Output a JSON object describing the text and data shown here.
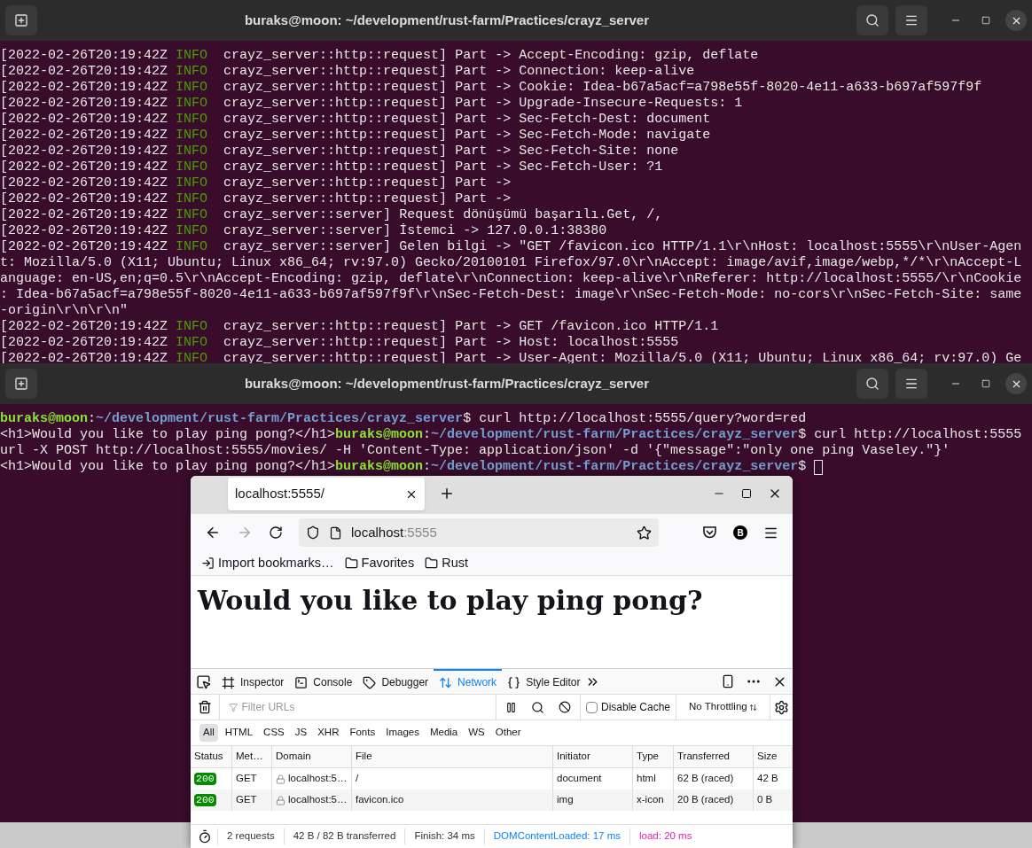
{
  "terminals": [
    {
      "title": "buraks@moon: ~/development/rust-farm/Practices/crayz_server",
      "lines": [
        {
          "kind": "log",
          "timestamp": "[2022-02-26T20:19:42Z",
          "level": "INFO",
          "target": "crayz_server::http::request]",
          "message": "Part -> Accept-Encoding: gzip, deflate"
        },
        {
          "kind": "log",
          "timestamp": "[2022-02-26T20:19:42Z",
          "level": "INFO",
          "target": "crayz_server::http::request]",
          "message": "Part -> Connection: keep-alive"
        },
        {
          "kind": "log",
          "timestamp": "[2022-02-26T20:19:42Z",
          "level": "INFO",
          "target": "crayz_server::http::request]",
          "message": "Part -> Cookie: Idea-b67a5acf=a798e55f-8020-4e11-a633-b697af597f9f"
        },
        {
          "kind": "log",
          "timestamp": "[2022-02-26T20:19:42Z",
          "level": "INFO",
          "target": "crayz_server::http::request]",
          "message": "Part -> Upgrade-Insecure-Requests: 1"
        },
        {
          "kind": "log",
          "timestamp": "[2022-02-26T20:19:42Z",
          "level": "INFO",
          "target": "crayz_server::http::request]",
          "message": "Part -> Sec-Fetch-Dest: document"
        },
        {
          "kind": "log",
          "timestamp": "[2022-02-26T20:19:42Z",
          "level": "INFO",
          "target": "crayz_server::http::request]",
          "message": "Part -> Sec-Fetch-Mode: navigate"
        },
        {
          "kind": "log",
          "timestamp": "[2022-02-26T20:19:42Z",
          "level": "INFO",
          "target": "crayz_server::http::request]",
          "message": "Part -> Sec-Fetch-Site: none"
        },
        {
          "kind": "log",
          "timestamp": "[2022-02-26T20:19:42Z",
          "level": "INFO",
          "target": "crayz_server::http::request]",
          "message": "Part -> Sec-Fetch-User: ?1"
        },
        {
          "kind": "log",
          "timestamp": "[2022-02-26T20:19:42Z",
          "level": "INFO",
          "target": "crayz_server::http::request]",
          "message": "Part ->"
        },
        {
          "kind": "log",
          "timestamp": "[2022-02-26T20:19:42Z",
          "level": "INFO",
          "target": "crayz_server::http::request]",
          "message": "Part ->"
        },
        {
          "kind": "log",
          "timestamp": "[2022-02-26T20:19:42Z",
          "level": "INFO",
          "target": "crayz_server::server]",
          "message": "Request dönüşümü başarılı.Get, /,"
        },
        {
          "kind": "log",
          "timestamp": "[2022-02-26T20:19:42Z",
          "level": "INFO",
          "target": "crayz_server::server]",
          "message": "İstemci -> 127.0.0.1:38380"
        },
        {
          "kind": "log",
          "timestamp": "[2022-02-26T20:19:42Z",
          "level": "INFO",
          "target": "crayz_server::server]",
          "message": "Gelen bilgi -> \"GET /favicon.ico HTTP/1.1\\r\\nHost: localhost:5555\\r\\nUser-Agen"
        },
        {
          "kind": "wrap",
          "text": "t: Mozilla/5.0 (X11; Ubuntu; Linux x86_64; rv:97.0) Gecko/20100101 Firefox/97.0\\r\\nAccept: image/avif,image/webp,*/*\\r\\nAccept-L"
        },
        {
          "kind": "wrap",
          "text": "anguage: en-US,en;q=0.5\\r\\nAccept-Encoding: gzip, deflate\\r\\nConnection: keep-alive\\r\\nReferer: http://localhost:5555/\\r\\nCookie"
        },
        {
          "kind": "wrap",
          "text": ": Idea-b67a5acf=a798e55f-8020-4e11-a633-b697af597f9f\\r\\nSec-Fetch-Dest: image\\r\\nSec-Fetch-Mode: no-cors\\r\\nSec-Fetch-Site: same"
        },
        {
          "kind": "wrap",
          "text": "-origin\\r\\n\\r\\n\""
        },
        {
          "kind": "log",
          "timestamp": "[2022-02-26T20:19:42Z",
          "level": "INFO",
          "target": "crayz_server::http::request]",
          "message": "Part -> GET /favicon.ico HTTP/1.1"
        },
        {
          "kind": "log",
          "timestamp": "[2022-02-26T20:19:42Z",
          "level": "INFO",
          "target": "crayz_server::http::request]",
          "message": "Part -> Host: localhost:5555"
        },
        {
          "kind": "log",
          "timestamp": "[2022-02-26T20:19:42Z",
          "level": "INFO",
          "target": "crayz_server::http::request]",
          "message": "Part -> User-Agent: Mozilla/5.0 (X11; Ubuntu; Linux x86_64; rv:97.0) Ge"
        }
      ]
    },
    {
      "title": "buraks@moon: ~/development/rust-farm/Practices/crayz_server",
      "lines": [
        {
          "kind": "shell",
          "segments": [
            {
              "kind": "user",
              "text": "buraks@moon"
            },
            {
              "kind": "plain",
              "text": ":"
            },
            {
              "kind": "path",
              "text": "~/development/rust-farm/Practices/crayz_server"
            },
            {
              "kind": "plain",
              "text": "$ curl http://localhost:5555/query?word=red"
            }
          ]
        },
        {
          "kind": "shell",
          "segments": [
            {
              "kind": "plain",
              "text": "<h1>Would you like to play ping pong?</h1>"
            },
            {
              "kind": "user",
              "text": "buraks@moon"
            },
            {
              "kind": "plain",
              "text": ":"
            },
            {
              "kind": "path",
              "text": "~/development/rust-farm/Practices/crayz_server"
            },
            {
              "kind": "plain",
              "text": "$ curl http://localhost:5555"
            }
          ]
        },
        {
          "kind": "shell",
          "segments": [
            {
              "kind": "plain",
              "text": "url -X POST http://localhost:5555/movies/ -H 'Content-Type: application/json' -d '{\"message\":\"only one ping Vaseley.\"}'"
            }
          ]
        },
        {
          "kind": "shell",
          "cursor": true,
          "segments": [
            {
              "kind": "plain",
              "text": "<h1>Would you like to play ping pong?</h1>"
            },
            {
              "kind": "user",
              "text": "buraks@moon"
            },
            {
              "kind": "plain",
              "text": ":"
            },
            {
              "kind": "path",
              "text": "~/development/rust-farm/Practices/crayz_server"
            },
            {
              "kind": "plain",
              "text": "$ "
            }
          ]
        }
      ]
    }
  ],
  "browser": {
    "tab": {
      "title": "localhost:5555/",
      "selected": true
    },
    "url": {
      "host": "localhost",
      "port": ":5555"
    },
    "bookmarks": [
      {
        "kind": "import",
        "label": "Import bookmarks…"
      },
      {
        "kind": "folder",
        "label": "Favorites"
      },
      {
        "kind": "folder",
        "label": "Rust"
      }
    ],
    "avatar": "B",
    "heading": "Would you like to play ping pong?",
    "devtools": {
      "tabs": [
        {
          "label": "Inspector",
          "selected": false
        },
        {
          "label": "Console",
          "selected": false
        },
        {
          "label": "Debugger",
          "selected": false
        },
        {
          "label": "Network",
          "selected": true
        },
        {
          "label": "Style Editor",
          "selected": false
        }
      ],
      "filter": {
        "placeholder": "Filter URLs"
      },
      "disable_cache": {
        "label": "Disable Cache",
        "checked": false
      },
      "throttling": "No Throttling",
      "types": [
        {
          "label": "All",
          "selected": true
        },
        {
          "label": "HTML",
          "selected": false
        },
        {
          "label": "CSS",
          "selected": false
        },
        {
          "label": "JS",
          "selected": false
        },
        {
          "label": "XHR",
          "selected": false
        },
        {
          "label": "Fonts",
          "selected": false
        },
        {
          "label": "Images",
          "selected": false
        },
        {
          "label": "Media",
          "selected": false
        },
        {
          "label": "WS",
          "selected": false
        },
        {
          "label": "Other",
          "selected": false
        }
      ],
      "columns": [
        "Status",
        "Met…",
        "Domain",
        "File",
        "Initiator",
        "Type",
        "Transferred",
        "Size"
      ],
      "rows": [
        {
          "status": "200",
          "method": "GET",
          "domain": "localhost:5…",
          "file": "/",
          "initiator": "document",
          "type": "html",
          "transferred": "62 B (raced)",
          "size": "42 B"
        },
        {
          "status": "200",
          "method": "GET",
          "domain": "localhost:5…",
          "file": "favicon.ico",
          "initiator": "img",
          "type": "x-icon",
          "transferred": "20 B (raced)",
          "size": "0 B"
        }
      ],
      "summary": [
        {
          "kind": "plain",
          "text": "2 requests"
        },
        {
          "kind": "plain",
          "text": "42 B / 82 B transferred"
        },
        {
          "kind": "plain",
          "text": "Finish: 34 ms"
        },
        {
          "kind": "dom",
          "text": "DOMContentLoaded: 17 ms"
        },
        {
          "kind": "load",
          "text": "load: 20 ms"
        }
      ]
    }
  }
}
